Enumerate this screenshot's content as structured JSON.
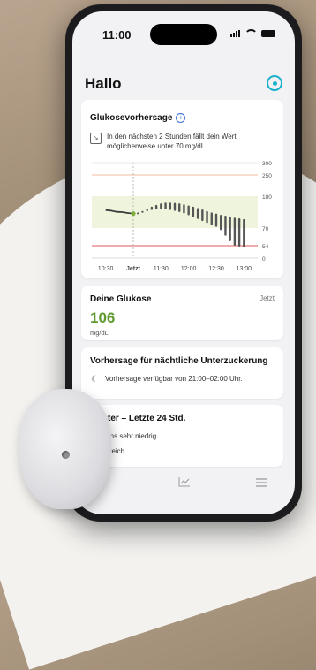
{
  "status_bar": {
    "time": "11:00"
  },
  "header": {
    "title": "Hallo"
  },
  "prediction_card": {
    "title": "Glukosevorhersage",
    "message": "In den nächsten 2 Stunden fällt dein Wert möglicherweise unter 70 mg/dL."
  },
  "chart_data": {
    "type": "line",
    "x_labels": [
      "10:30",
      "Jetzt",
      "11:30",
      "12:00",
      "12:30",
      "13:00"
    ],
    "y_ticks": [
      300,
      250,
      180,
      70,
      54,
      0
    ],
    "ylim": [
      0,
      300
    ],
    "target_range": [
      70,
      180
    ],
    "threshold_lines": [
      {
        "value": 250,
        "color": "#f0b89c"
      },
      {
        "value": 54,
        "color": "#e05a5a"
      }
    ],
    "history": {
      "x": [
        -30,
        -24,
        -18,
        -12,
        -6,
        0
      ],
      "y": [
        132,
        130,
        126,
        125,
        122,
        120
      ]
    },
    "forecast": {
      "x": [
        5,
        10,
        15,
        20,
        25,
        30,
        35,
        40,
        45,
        50,
        55,
        60,
        65,
        70,
        75,
        80,
        85,
        90,
        95,
        100,
        105,
        110,
        115,
        120
      ],
      "y": [
        122,
        126,
        132,
        138,
        142,
        145,
        146,
        145,
        143,
        140,
        136,
        131,
        126,
        120,
        114,
        108,
        102,
        97,
        92,
        88,
        84,
        80,
        77,
        74
      ],
      "spread": [
        2,
        3,
        4,
        6,
        8,
        10,
        12,
        13,
        14,
        15,
        16,
        17,
        18,
        19,
        20,
        21,
        22,
        23,
        24,
        25,
        26,
        26,
        27,
        27
      ]
    },
    "colors": {
      "history": "#3a3a3a",
      "forecast": "#555555",
      "now_marker": "#7fae3c",
      "target_band": "#eef5dc"
    }
  },
  "glucose_card": {
    "title": "Deine Glukose",
    "time_label": "Jetzt",
    "value": "106",
    "unit": "mg/dL"
  },
  "nocturnal_card": {
    "title": "Vorhersage für nächtliche Unterzuckerung",
    "message": "Vorhersage verfügbar von 21:00–02:00 Uhr."
  },
  "pattern_card": {
    "title": "Muster – Letzte 24 Std.",
    "item1": "Morgens sehr niedrig",
    "item2": "Zielbereich"
  },
  "tab_bar": {
    "icons": [
      "chart-icon",
      "menu-icon"
    ]
  }
}
